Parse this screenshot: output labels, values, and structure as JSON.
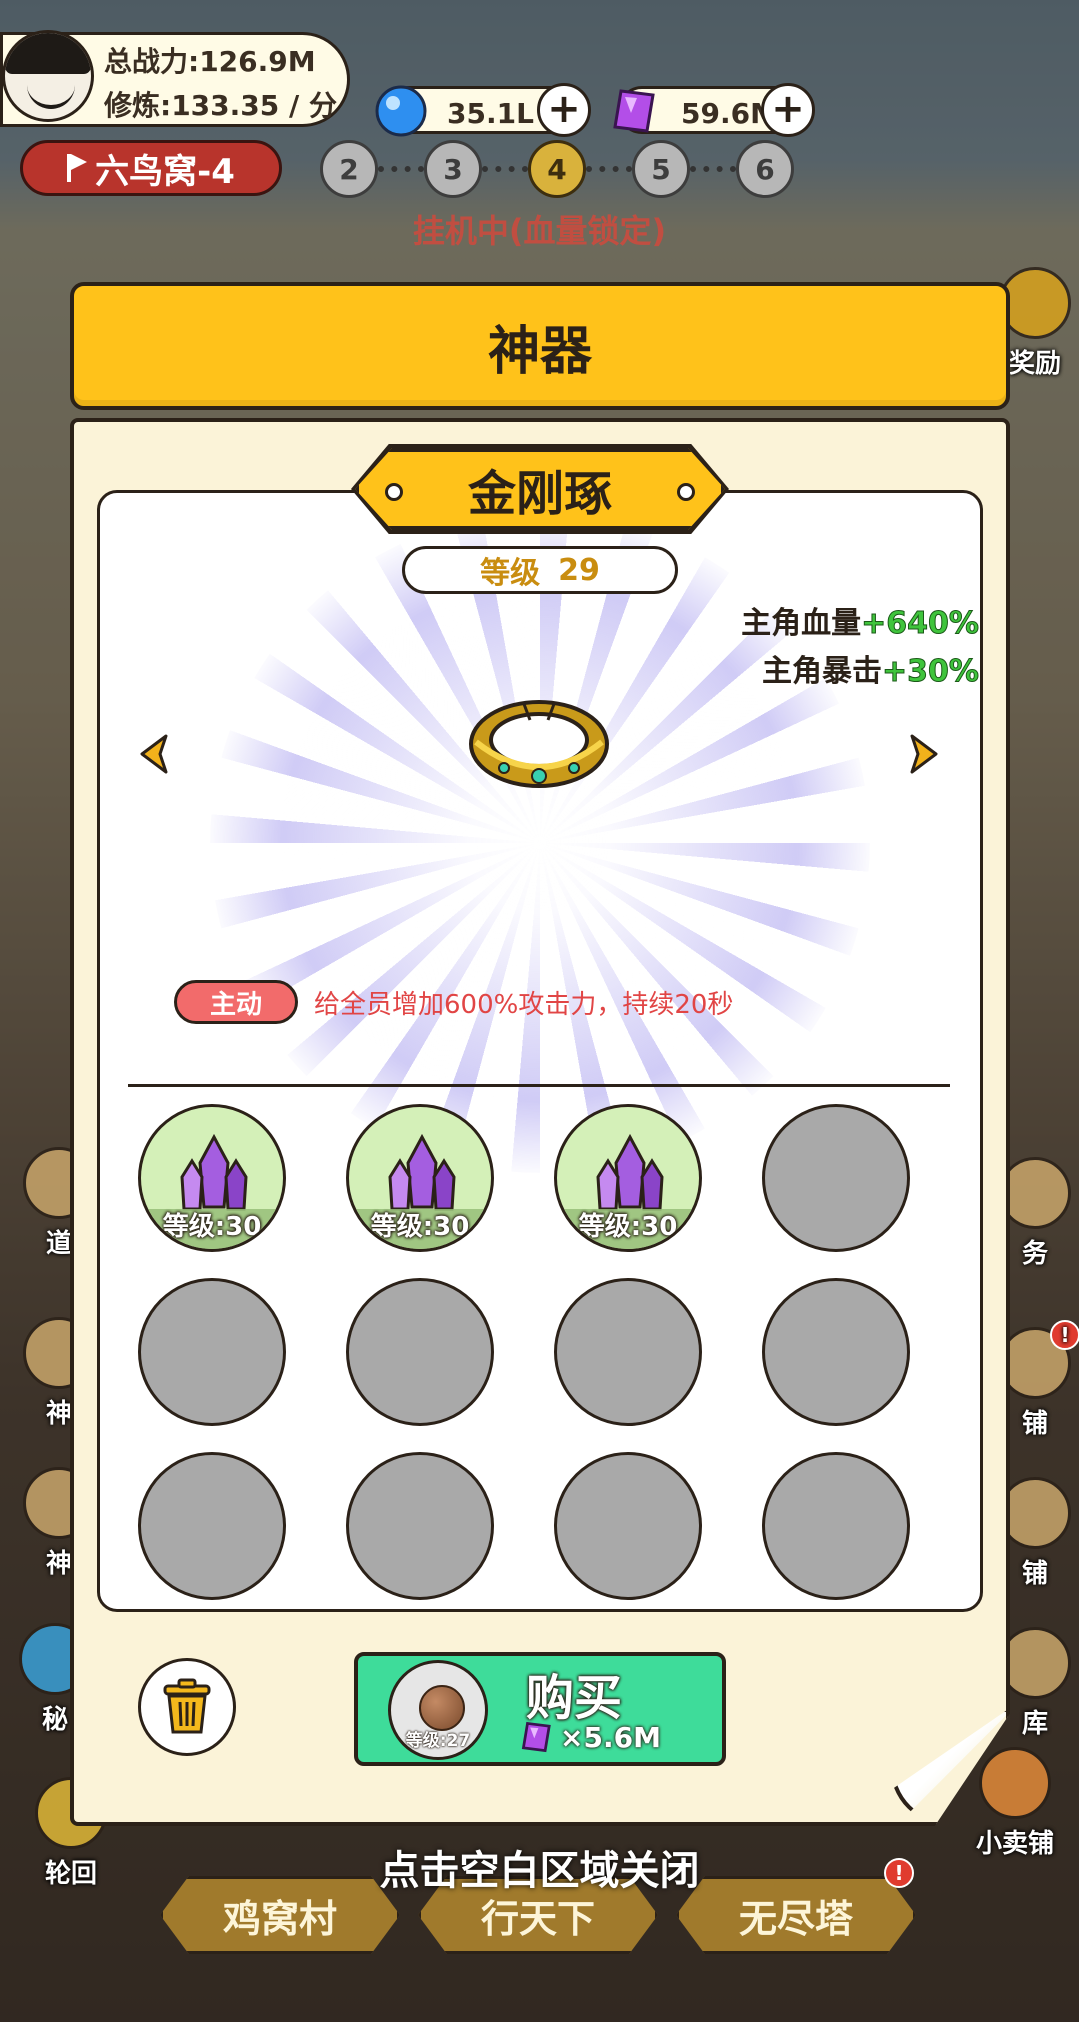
{
  "hud": {
    "total_power": "总战力:126.9M",
    "cultivation": "修炼:133.35 / 分",
    "blue_currency": "35.1L",
    "purple_currency": "59.6M",
    "stage_name": "六鸟窝-4",
    "stage_nodes": [
      "2",
      "3",
      "4",
      "5",
      "6"
    ],
    "active_stage": "4",
    "idle_status": "挂机中(血量锁定)"
  },
  "side_menu": {
    "left": [
      "道",
      "神",
      "神",
      "秘",
      "轮回"
    ],
    "right": [
      "奖励",
      "务",
      "铺",
      "铺",
      "库",
      "小卖铺"
    ]
  },
  "modal": {
    "title": "神器",
    "artifact_name": "金刚琢",
    "level_label": "等级",
    "level_value": "29",
    "stats": [
      {
        "label": "主角血量",
        "value": "+640%"
      },
      {
        "label": "主角暴击",
        "value": "+30%"
      }
    ],
    "skill_tag": "主动",
    "skill_desc": "给全员增加600%攻击力，持续20秒",
    "slots": [
      {
        "filled": true,
        "level": "等级:30"
      },
      {
        "filled": true,
        "level": "等级:30"
      },
      {
        "filled": true,
        "level": "等级:30"
      },
      {
        "filled": false,
        "level": ""
      },
      {
        "filled": false,
        "level": ""
      },
      {
        "filled": false,
        "level": ""
      },
      {
        "filled": false,
        "level": ""
      },
      {
        "filled": false,
        "level": ""
      },
      {
        "filled": false,
        "level": ""
      },
      {
        "filled": false,
        "level": ""
      },
      {
        "filled": false,
        "level": ""
      },
      {
        "filled": false,
        "level": ""
      }
    ],
    "buy": {
      "label": "购买",
      "thumb_level": "等级:27",
      "price": "×5.6M"
    }
  },
  "close_hint": "点击空白区域关闭",
  "bottom_nav": [
    "鸡窝村",
    "行天下",
    "无尽塔"
  ],
  "colors": {
    "header_yellow": "#ffc21a",
    "buy_green": "#3edc9a",
    "stat_green": "#3fc43c",
    "skill_red": "#e14545"
  }
}
